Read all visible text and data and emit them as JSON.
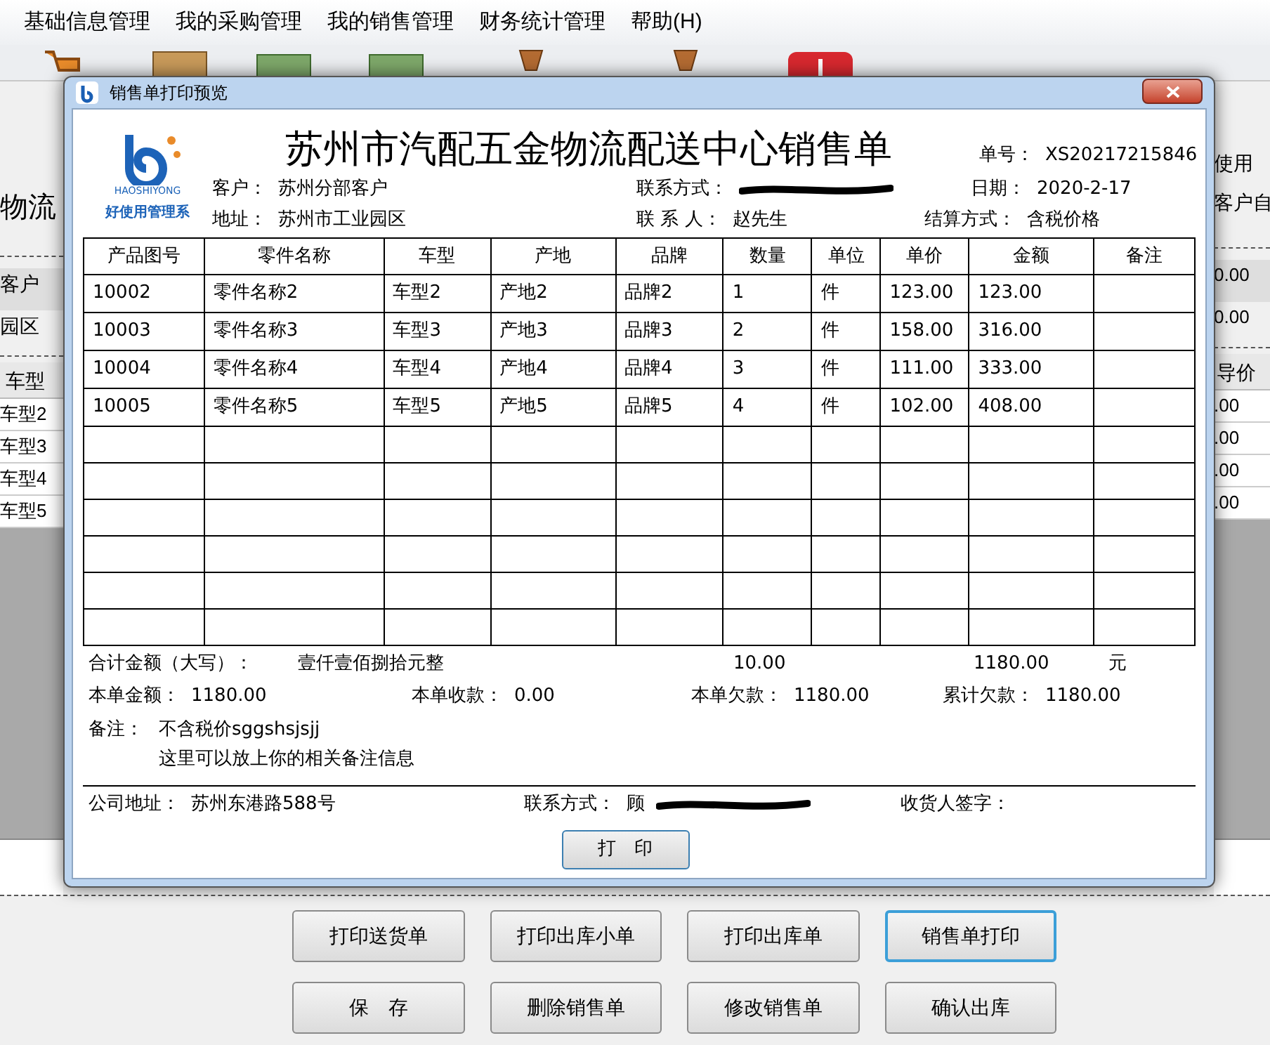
{
  "menu": [
    "基础信息管理",
    "我的采购管理",
    "我的销售管理",
    "财务统计管理",
    "帮助(H)"
  ],
  "background": {
    "left_heading": "物流",
    "right_texts": [
      "使用",
      "客户自"
    ],
    "left_fields": [
      "客户",
      "园区"
    ],
    "right_fields": [
      "0.00",
      "0.00"
    ],
    "grid_header_left": "车型",
    "grid_header_right": "导价",
    "grid_left": [
      "车型2",
      "车型3",
      "车型4",
      "车型5"
    ],
    "grid_right": [
      ".00",
      ".00",
      ".00",
      ".00"
    ]
  },
  "dialog": {
    "title": "销售单打印预览",
    "logo_text": "好使用管理系",
    "logo_arc": "HAOSHIYONG",
    "heading": "苏州市汽配五金物流配送中心销售单",
    "order_no": {
      "label": "单号：",
      "value": "XS20217215846"
    },
    "customer": {
      "label": "客户：",
      "value": "苏州分部客户"
    },
    "contact": {
      "label": "联系方式：",
      "redacted": true
    },
    "date": {
      "label": "日期：",
      "value": "2020-2-17"
    },
    "address": {
      "label": "地址：",
      "value": "苏州市工业园区"
    },
    "contact_person": {
      "label": "联 系 人：",
      "value": "赵先生"
    },
    "settlement": {
      "label": "结算方式：",
      "value": "含税价格"
    },
    "table": {
      "columns": [
        "产品图号",
        "零件名称",
        "车型",
        "产地",
        "品牌",
        "数量",
        "单位",
        "单价",
        "金额",
        "备注"
      ],
      "rows": [
        [
          "10002",
          "零件名称2",
          "车型2",
          "产地2",
          "品牌2",
          "1",
          "件",
          "123.00",
          "123.00",
          ""
        ],
        [
          "10003",
          "零件名称3",
          "车型3",
          "产地3",
          "品牌3",
          "2",
          "件",
          "158.00",
          "316.00",
          ""
        ],
        [
          "10004",
          "零件名称4",
          "车型4",
          "产地4",
          "品牌4",
          "3",
          "件",
          "111.00",
          "333.00",
          ""
        ],
        [
          "10005",
          "零件名称5",
          "车型5",
          "产地5",
          "品牌5",
          "4",
          "件",
          "102.00",
          "408.00",
          ""
        ]
      ]
    },
    "total_words": {
      "label": "合计金额（大写）：",
      "value": "壹仟壹佰捌拾元整"
    },
    "total_qty": "10.00",
    "total_amount": "1180.00",
    "currency": "元",
    "amounts": [
      {
        "label": "本单金额：",
        "value": "1180.00"
      },
      {
        "label": "本单收款：",
        "value": "0.00"
      },
      {
        "label": "本单欠款：",
        "value": "1180.00"
      },
      {
        "label": "累计欠款：",
        "value": "1180.00"
      }
    ],
    "remark": {
      "label": "备注：",
      "lines": [
        "不含税价sggshsjsjj",
        "这里可以放上你的相关备注信息"
      ]
    },
    "company_address": {
      "label": "公司地址：",
      "value": "苏州东港路588号"
    },
    "footer_contact": {
      "label": "联系方式：",
      "value": "顾",
      "redacted": true
    },
    "signature": {
      "label": "收货人签字："
    },
    "print_button": "打　印"
  },
  "buttons": [
    {
      "label": "打印送货单",
      "focused": false
    },
    {
      "label": "打印出库小单",
      "focused": false
    },
    {
      "label": "打印出库单",
      "focused": false
    },
    {
      "label": "销售单打印",
      "focused": true
    },
    {
      "label": "保　存",
      "focused": false
    },
    {
      "label": "删除销售单",
      "focused": false
    },
    {
      "label": "修改销售单",
      "focused": false
    },
    {
      "label": "确认出库",
      "focused": false
    }
  ]
}
